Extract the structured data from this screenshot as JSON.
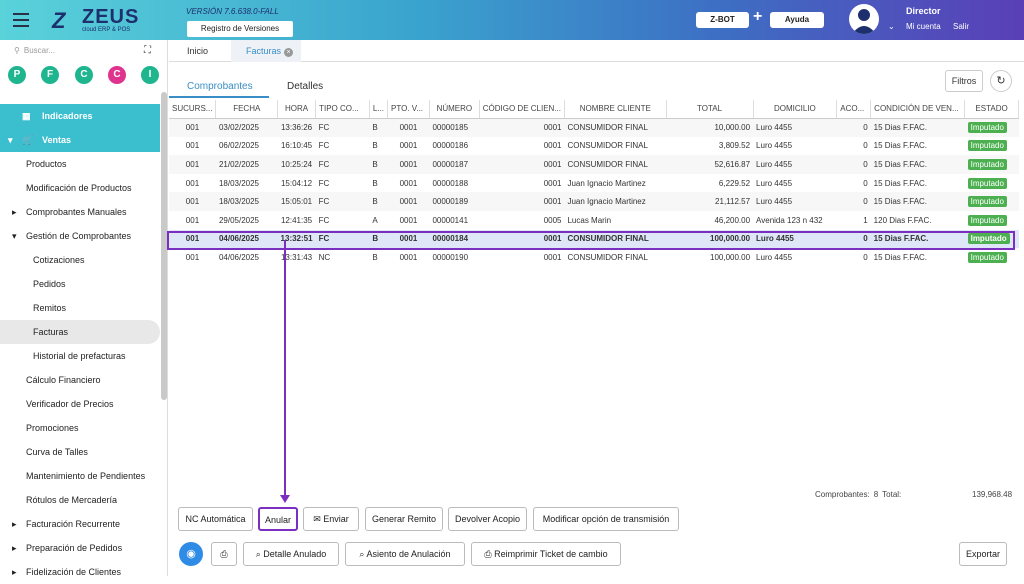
{
  "header": {
    "logo_text": "ZEUS",
    "logo_sub": "cloud ERP & POS",
    "version": "VERSIÓN 7.6.638.0-FALL",
    "registro_label": "Registro de Versiones",
    "zbot_label": "Z-BOT",
    "ayuda_label": "Ayuda",
    "user_name": "Director",
    "mi_cuenta": "Mi cuenta",
    "salir": "Salir"
  },
  "sidebar": {
    "search_placeholder": "Buscar...",
    "shortcuts": [
      {
        "letter": "P",
        "color": "#1fb58f"
      },
      {
        "letter": "F",
        "color": "#1fb58f"
      },
      {
        "letter": "C",
        "color": "#1fb58f"
      },
      {
        "letter": "C",
        "color": "#e0338e"
      },
      {
        "letter": "I",
        "color": "#1fb58f"
      }
    ],
    "indicadores": "Indicadores",
    "ventas": "Ventas",
    "items": [
      "Productos",
      "Modificación de Productos",
      "Comprobantes Manuales",
      "Gestión de Comprobantes",
      "Cotizaciones",
      "Pedidos",
      "Remitos",
      "Facturas",
      "Historial de prefacturas",
      "Cálculo Financiero",
      "Verificador de Precios",
      "Promociones",
      "Curva de Talles",
      "Mantenimiento de Pendientes",
      "Rótulos de Mercadería",
      "Facturación Recurrente",
      "Preparación de Pedidos",
      "Fidelización de Clientes"
    ]
  },
  "tabs": {
    "inicio": "Inicio",
    "facturas": "Facturas"
  },
  "subtabs": {
    "comprobantes": "Comprobantes",
    "detalles": "Detalles"
  },
  "filtros_label": "Filtros",
  "table": {
    "columns": [
      "SUCURS...",
      "FECHA",
      "HORA",
      "TIPO CO...",
      "L...",
      "PTO. V...",
      "NÚMERO",
      "CÓDIGO DE CLIEN...",
      "NOMBRE CLIENTE",
      "TOTAL",
      "DOMICILIO",
      "ACO...",
      "CONDICIÓN DE VEN...",
      "ESTADO"
    ],
    "rows": [
      [
        "001",
        "03/02/2025",
        "13:36:26",
        "FC",
        "B",
        "0001",
        "00000185",
        "0001",
        "CONSUMIDOR FINAL",
        "10,000.00",
        "Luro 4455",
        "0",
        "15 Dias F.FAC.",
        "Imputado"
      ],
      [
        "001",
        "06/02/2025",
        "16:10:45",
        "FC",
        "B",
        "0001",
        "00000186",
        "0001",
        "CONSUMIDOR FINAL",
        "3,809.52",
        "Luro 4455",
        "0",
        "15 Dias F.FAC.",
        "Imputado"
      ],
      [
        "001",
        "21/02/2025",
        "10:25:24",
        "FC",
        "B",
        "0001",
        "00000187",
        "0001",
        "CONSUMIDOR FINAL",
        "52,616.87",
        "Luro 4455",
        "0",
        "15 Dias F.FAC.",
        "Imputado"
      ],
      [
        "001",
        "18/03/2025",
        "15:04:12",
        "FC",
        "B",
        "0001",
        "00000188",
        "0001",
        "Juan Ignacio Martinez",
        "6,229.52",
        "Luro 4455",
        "0",
        "15 Dias F.FAC.",
        "Imputado"
      ],
      [
        "001",
        "18/03/2025",
        "15:05:01",
        "FC",
        "B",
        "0001",
        "00000189",
        "0001",
        "Juan Ignacio Martinez",
        "21,112.57",
        "Luro 4455",
        "0",
        "15 Dias F.FAC.",
        "Imputado"
      ],
      [
        "001",
        "29/05/2025",
        "12:41:35",
        "FC",
        "A",
        "0001",
        "00000141",
        "0005",
        "Lucas Marin",
        "46,200.00",
        "Avenida 123 n 432",
        "1",
        "120 Dias F.FAC.",
        "Imputado"
      ],
      [
        "001",
        "04/06/2025",
        "13:32:51",
        "FC",
        "B",
        "0001",
        "00000184",
        "0001",
        "CONSUMIDOR FINAL",
        "100,000.00",
        "Luro 4455",
        "0",
        "15 Dias F.FAC.",
        "Imputado"
      ],
      [
        "001",
        "04/06/2025",
        "13:31:43",
        "NC",
        "B",
        "0001",
        "00000190",
        "0001",
        "CONSUMIDOR FINAL",
        "100,000.00",
        "Luro 4455",
        "0",
        "15 Dias F.FAC.",
        "Imputado"
      ]
    ]
  },
  "totals": {
    "comprobantes_label": "Comprobantes:",
    "comprobantes_value": "8",
    "total_label": "Total:",
    "total_value": "139,968.48"
  },
  "actions": {
    "nc_automatica": "NC Automática",
    "anular": "Anular",
    "enviar": "Enviar",
    "generar_remito": "Generar Remito",
    "devolver_acopio": "Devolver Acopio",
    "modificar_transmision": "Modificar opción de transmisión",
    "detalle_anulado": "Detalle Anulado",
    "asiento_anulacion": "Asiento de Anulación",
    "reimprimir": "Reimprimir Ticket de cambio",
    "exportar": "Exportar"
  }
}
